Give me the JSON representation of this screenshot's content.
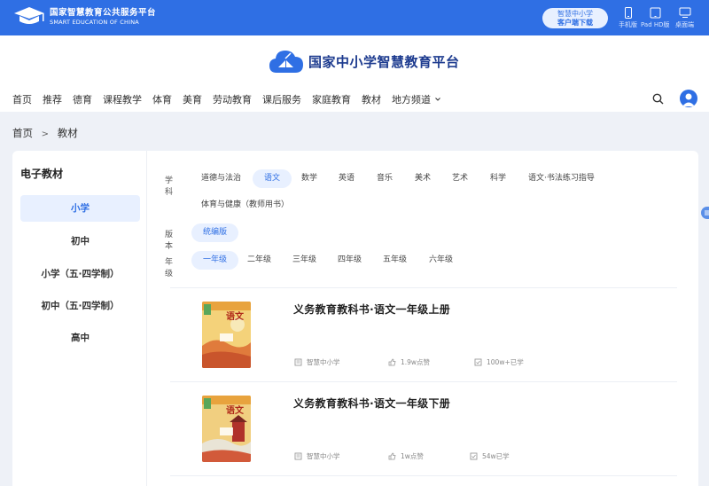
{
  "topbar": {
    "brand_cn": "国家智慧教育公共服务平台",
    "brand_en": "SMART EDUCATION OF CHINA",
    "client_line1": "智慧中小学",
    "client_line2": "客户端下载",
    "devices": [
      {
        "label": "手机版",
        "icon": "phone-icon"
      },
      {
        "label": "Pad HD版",
        "icon": "tablet-icon"
      },
      {
        "label": "桌面端",
        "icon": "desktop-icon"
      }
    ]
  },
  "header": {
    "site_title": "国家中小学智慧教育平台",
    "nav": [
      "首页",
      "推荐",
      "德育",
      "课程教学",
      "体育",
      "美育",
      "劳动教育",
      "课后服务",
      "家庭教育",
      "教材",
      "地方频道"
    ]
  },
  "breadcrumb": {
    "home": "首页",
    "separator": ">",
    "current": "教材"
  },
  "sidebar": {
    "title": "电子教材",
    "items": [
      "小学",
      "初中",
      "小学（五·四学制）",
      "初中（五·四学制）",
      "高中"
    ],
    "active_index": 0
  },
  "filters": {
    "subject_label": "学科",
    "subjects": [
      "道德与法治",
      "语文",
      "数学",
      "英语",
      "音乐",
      "美术",
      "艺术",
      "科学",
      "语文·书法练习指导",
      "体育与健康（教师用书）"
    ],
    "subject_active": "语文",
    "edition_label": "版本",
    "editions": [
      "统编版"
    ],
    "edition_active": "统编版",
    "grade_label": "年级",
    "grades": [
      "一年级",
      "二年级",
      "三年级",
      "四年级",
      "五年级",
      "六年级"
    ],
    "grade_active": "一年级"
  },
  "books": [
    {
      "title": "义务教育教科书·语文一年级上册",
      "publisher": "智慧中小学",
      "likes": "1.9w点赞",
      "learners": "100w+已学",
      "cover_text": "语文"
    },
    {
      "title": "义务教育教科书·语文一年级下册",
      "publisher": "智慧中小学",
      "likes": "1w点赞",
      "learners": "54w已学",
      "cover_text": "语文"
    }
  ],
  "colors": {
    "brand_blue": "#2f6fe4",
    "active_bg": "#e8f0ff",
    "page_bg": "#eef1f7"
  }
}
